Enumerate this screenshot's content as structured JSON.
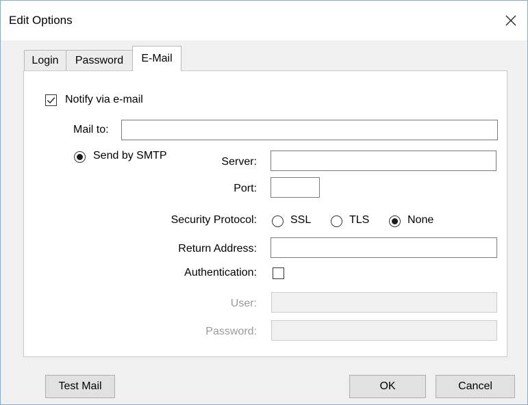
{
  "window": {
    "title": "Edit Options",
    "close_icon": "close-icon"
  },
  "tabs": [
    {
      "label": "Login",
      "active": false
    },
    {
      "label": "Password",
      "active": false
    },
    {
      "label": "E-Mail",
      "active": true
    }
  ],
  "email_tab": {
    "notify_label": "Notify via e-mail",
    "notify_checked": true,
    "mail_to_label": "Mail to:",
    "mail_to_value": "",
    "send_smtp_label": "Send by SMTP",
    "send_smtp_selected": true,
    "server_label": "Server:",
    "server_value": "",
    "port_label": "Port:",
    "port_value": "",
    "security_label": "Security Protocol:",
    "security_options": [
      {
        "label": "SSL",
        "selected": false
      },
      {
        "label": "TLS",
        "selected": false
      },
      {
        "label": "None",
        "selected": true
      }
    ],
    "return_address_label": "Return Address:",
    "return_address_value": "",
    "authentication_label": "Authentication:",
    "authentication_checked": false,
    "user_label": "User:",
    "user_value": "",
    "password_label": "Password:",
    "password_value": ""
  },
  "buttons": {
    "test_mail": "Test Mail",
    "ok": "OK",
    "cancel": "Cancel"
  }
}
